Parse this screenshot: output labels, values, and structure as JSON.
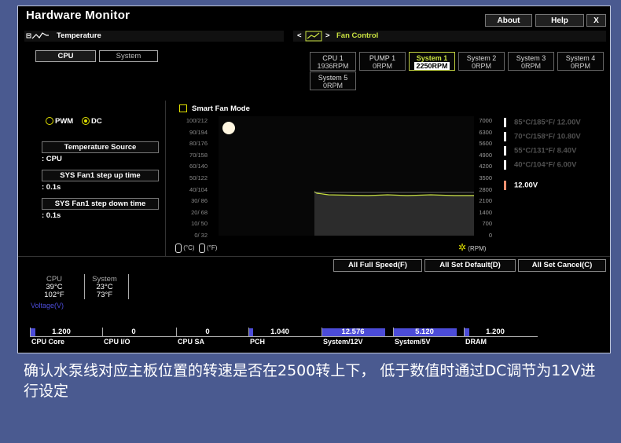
{
  "app": {
    "title": "Hardware Monitor",
    "buttons": {
      "about": "About",
      "help": "Help",
      "close": "X"
    }
  },
  "temperature_section": {
    "label": "Temperature",
    "icon": "line-graph-icon",
    "tabs": [
      {
        "label": "CPU",
        "active": true
      },
      {
        "label": "System",
        "active": false
      }
    ]
  },
  "fan_control": {
    "label": "Fan Control",
    "left_arrow": "<",
    "right_arrow": ">",
    "icon": "fan-graph-icon",
    "fans": [
      {
        "name": "CPU 1",
        "value": "1936RPM",
        "active": false
      },
      {
        "name": "PUMP 1",
        "value": "0RPM",
        "active": false
      },
      {
        "name": "System 1",
        "value": "2250RPM",
        "active": true
      },
      {
        "name": "System 2",
        "value": "0RPM",
        "active": false
      },
      {
        "name": "System 3",
        "value": "0RPM",
        "active": false
      },
      {
        "name": "System 4",
        "value": "0RPM",
        "active": false
      },
      {
        "name": "System 5",
        "value": "0RPM",
        "active": false
      }
    ]
  },
  "mode": {
    "pwm": "PWM",
    "dc": "DC",
    "selected": "DC"
  },
  "settings": {
    "temperature_source": {
      "label": "Temperature Source",
      "value": ": CPU"
    },
    "step_up": {
      "label": "SYS Fan1 step up time",
      "value": ": 0.1s"
    },
    "step_down": {
      "label": "SYS Fan1 step down time",
      "value": ": 0.1s"
    }
  },
  "smart_fan": {
    "label": "Smart Fan Mode",
    "temp_ticks": [
      "100/212",
      "90/194",
      "80/176",
      "70/158",
      "60/140",
      "50/122",
      "40/104",
      "30/ 86",
      "20/ 68",
      "10/ 50",
      "0/ 32"
    ],
    "rpm_ticks": [
      "7000",
      "6300",
      "5600",
      "4900",
      "4200",
      "3500",
      "2800",
      "2100",
      "1400",
      "700",
      "0"
    ],
    "unit_c": "(°C)",
    "unit_f": "(°F)",
    "unit_rpm": "(RPM)",
    "voltage_rows": [
      {
        "label": "85°C/185°F/  12.00V",
        "active": false
      },
      {
        "label": "70°C/158°F/  10.80V",
        "active": false
      },
      {
        "label": "55°C/131°F/   8.40V",
        "active": false
      },
      {
        "label": "40°C/104°F/   6.00V",
        "active": false
      }
    ],
    "current_voltage": "12.00V",
    "accent_color": "#c8e040"
  },
  "global_buttons": {
    "full_speed": "All Full Speed(F)",
    "set_default": "All Set Default(D)",
    "set_cancel": "All Set Cancel(C)"
  },
  "temps": [
    {
      "name": "CPU",
      "c": "39°C",
      "f": "102°F"
    },
    {
      "name": "System",
      "c": "23°C",
      "f": "73°F"
    }
  ],
  "voltage_label": "Voltage(V)",
  "voltages": [
    {
      "name": "CPU Core",
      "value": "1.200",
      "fill": 0.08
    },
    {
      "name": "CPU I/O",
      "value": "0",
      "fill": 0
    },
    {
      "name": "CPU SA",
      "value": "0",
      "fill": 0
    },
    {
      "name": "PCH",
      "value": "1.040",
      "fill": 0.07
    },
    {
      "name": "System/12V",
      "value": "12.576",
      "fill": 0.95
    },
    {
      "name": "System/5V",
      "value": "5.120",
      "fill": 0.95
    },
    {
      "name": "DRAM",
      "value": "1.200",
      "fill": 0.08
    }
  ],
  "caption": "确认水泵线对应主板位置的转速是否在2500转上下， 低于数值时通过DC调节为12V进行设定"
}
